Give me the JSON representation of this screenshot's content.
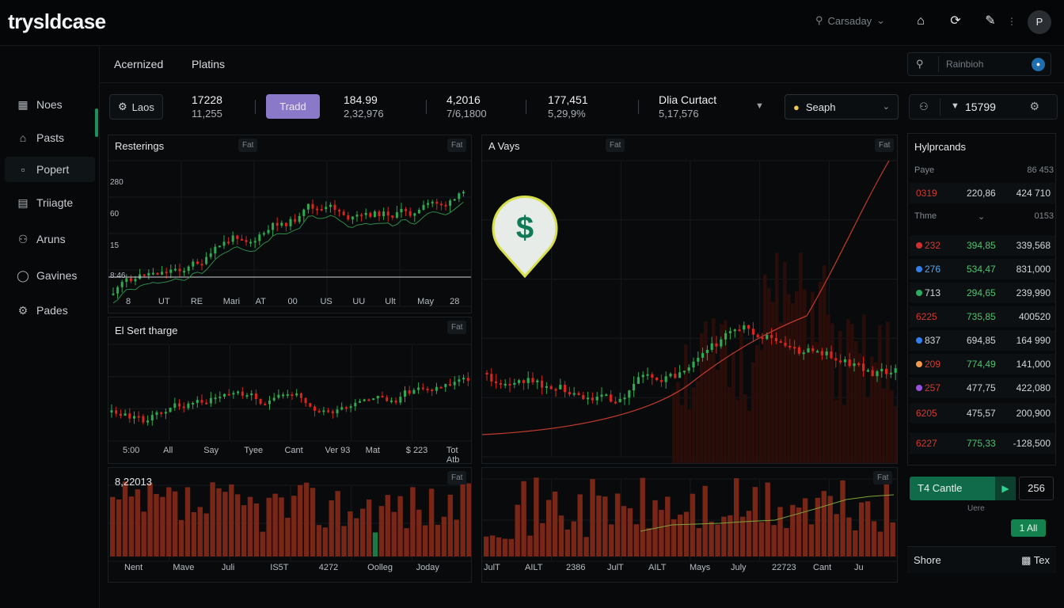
{
  "app": {
    "logo": "trysldcase"
  },
  "header": {
    "search_text": "Carsaday",
    "avatar": "P"
  },
  "sidebar": {
    "items": [
      {
        "label": "Noes",
        "icon": "grid-icon"
      },
      {
        "label": "Pasts",
        "icon": "home-icon"
      },
      {
        "label": "Popert",
        "icon": "box-icon"
      },
      {
        "label": "Triiagte",
        "icon": "doc-icon"
      },
      {
        "label": "Aruns",
        "icon": "users-icon"
      },
      {
        "label": "Gavines",
        "icon": "globe-icon"
      },
      {
        "label": "Pades",
        "icon": "settings-icon"
      }
    ]
  },
  "tabs": [
    {
      "label": "Acernized"
    },
    {
      "label": "Platins"
    }
  ],
  "search": {
    "placeholder": "Rainbioh"
  },
  "stats": {
    "chip_label": "Laos",
    "trade_button": "Tradd",
    "items": [
      {
        "v1": "17228",
        "v2": "11,255"
      },
      {
        "v1": "184.99",
        "v2": "2,32,976"
      },
      {
        "v1": "4,2016",
        "v2": "7/6,1800"
      },
      {
        "v1": "177,451",
        "v2": "5,29,9%"
      },
      {
        "v1": "Dlia Curtact",
        "v2": "5,17,576"
      }
    ],
    "select_label": "Seaph",
    "right_value": "15799"
  },
  "panels": {
    "p1": {
      "title": "Resterings",
      "badge": "Fat",
      "badge2": "Fat",
      "yticks": [
        "280",
        "60",
        "15",
        "8:46"
      ],
      "xticks": [
        "8",
        "UT",
        "RE",
        "Mari",
        "AT",
        "00",
        "US",
        "UU",
        "Ult",
        "May",
        "28"
      ]
    },
    "p2": {
      "title": "El Sert tharge",
      "badge": "Fat",
      "xticks": [
        "5:00",
        "All",
        "Say",
        "Tyee",
        "Cant",
        "Ver 93",
        "Mat",
        "$ 223",
        "Tot Atb"
      ]
    },
    "p3": {
      "title": "8,22013",
      "badge": "Fat",
      "xticks": [
        "Nent",
        "Mave",
        "Juli",
        "IS5T",
        "4272",
        "Oolleg",
        "Joday"
      ]
    },
    "p4": {
      "title": "A Vays",
      "badge": "Fat",
      "badge2": "Fat"
    },
    "p5": {
      "badge": "Fat",
      "xticks": [
        "JulT",
        "AILT",
        "2386",
        "JulT",
        "AILT",
        "Mays",
        "July",
        "22723",
        "Cant",
        "Ju"
      ]
    }
  },
  "book": {
    "title": "Hylprcands",
    "head1": {
      "a": "Paye",
      "c": "86 453"
    },
    "head2": {
      "a": "Thme",
      "b": "⌄",
      "c": "0153"
    },
    "rows": [
      {
        "a": "0319",
        "b": "220,86",
        "c": "424 710",
        "ac": "#d23b2e",
        "bc": "#d3d7db",
        "dot": ""
      },
      {
        "a": "232",
        "b": "394,85",
        "c": "339,568",
        "ac": "#d23b2e",
        "bc": "#4fc46f",
        "dot": "#d32f2f"
      },
      {
        "a": "276",
        "b": "534,47",
        "c": "831,000",
        "ac": "#5aa6e6",
        "bc": "#4fc46f",
        "dot": "#2f80ed"
      },
      {
        "a": "713",
        "b": "294,65",
        "c": "239,990",
        "ac": "#d3d7db",
        "bc": "#4fc46f",
        "dot": "#27ae60"
      },
      {
        "a": "6225",
        "b": "735,85",
        "c": "400520",
        "ac": "#d23b2e",
        "bc": "#4fc46f",
        "dot": ""
      },
      {
        "a": "837",
        "b": "694,85",
        "c": "164 990",
        "ac": "#d3d7db",
        "bc": "#d3d7db",
        "dot": "#2f80ed"
      },
      {
        "a": "209",
        "b": "774,49",
        "c": "141,000",
        "ac": "#d23b2e",
        "bc": "#4fc46f",
        "dot": "#f2994a"
      },
      {
        "a": "257",
        "b": "477,75",
        "c": "422,080",
        "ac": "#d23b2e",
        "bc": "#d3d7db",
        "dot": "#9b51e0"
      },
      {
        "a": "6205",
        "b": "475,57",
        "c": "200,900",
        "ac": "#d23b2e",
        "bc": "#d3d7db",
        "dot": ""
      },
      {
        "a": "6227",
        "b": "775,33",
        "c": "-128,500",
        "ac": "#d23b2e",
        "bc": "#4fc46f",
        "dot": ""
      }
    ]
  },
  "controls": {
    "bar_label": "T4 Cantle",
    "num": "256",
    "label": "Uere",
    "green": "1 All"
  },
  "share": {
    "left": "Shore",
    "right": "Tex"
  }
}
